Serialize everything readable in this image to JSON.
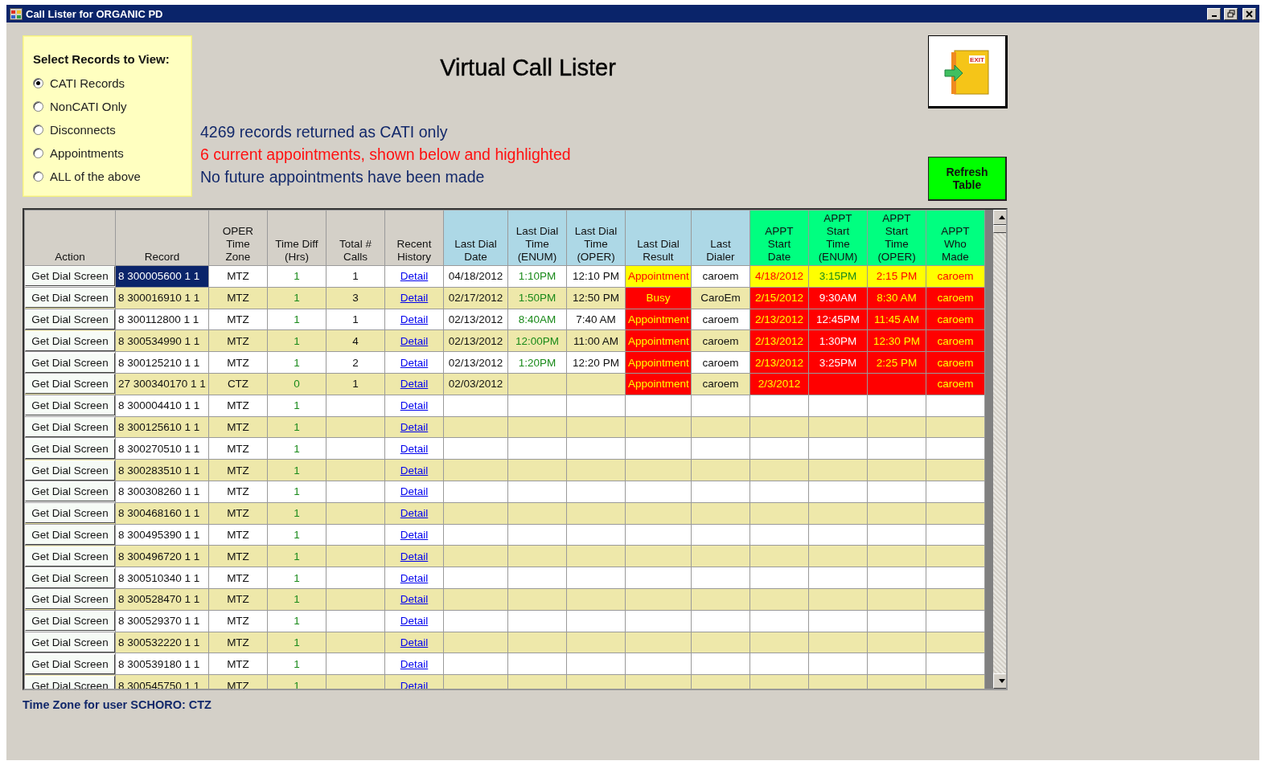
{
  "window": {
    "title": "Call Lister for ORGANIC PD"
  },
  "filter": {
    "heading": "Select Records to View:",
    "options": [
      {
        "label": "CATI Records",
        "selected": true
      },
      {
        "label": "NonCATI Only",
        "selected": false
      },
      {
        "label": "Disconnects",
        "selected": false
      },
      {
        "label": "Appointments",
        "selected": false
      },
      {
        "label": "ALL of the above",
        "selected": false
      }
    ]
  },
  "title": "Virtual Call Lister",
  "messages": [
    {
      "text": "4269 records returned as CATI only",
      "kind": "info"
    },
    {
      "text": "6 current appointments, shown below and highlighted",
      "kind": "alert"
    },
    {
      "text": "No future appointments have been made",
      "kind": "info"
    }
  ],
  "exit_button": {
    "label": "EXIT"
  },
  "refresh_button": {
    "label": "Refresh Table"
  },
  "table": {
    "columns": [
      {
        "lines": [
          "Action"
        ],
        "kind": "base"
      },
      {
        "lines": [
          "Record"
        ],
        "kind": "base"
      },
      {
        "lines": [
          "OPER",
          "Time",
          "Zone"
        ],
        "kind": "base"
      },
      {
        "lines": [
          "Time Diff",
          "(Hrs)"
        ],
        "kind": "base"
      },
      {
        "lines": [
          "Total #",
          "Calls"
        ],
        "kind": "base"
      },
      {
        "lines": [
          "Recent",
          "History"
        ],
        "kind": "base"
      },
      {
        "lines": [
          "Last Dial",
          "Date"
        ],
        "kind": "dial"
      },
      {
        "lines": [
          "Last Dial",
          "Time",
          "(ENUM)"
        ],
        "kind": "dial"
      },
      {
        "lines": [
          "Last Dial",
          "Time",
          "(OPER)"
        ],
        "kind": "dial"
      },
      {
        "lines": [
          "Last Dial",
          "Result"
        ],
        "kind": "dial"
      },
      {
        "lines": [
          "Last",
          "Dialer"
        ],
        "kind": "dial"
      },
      {
        "lines": [
          "APPT",
          "Start",
          "Date"
        ],
        "kind": "appt"
      },
      {
        "lines": [
          "APPT",
          "Start",
          "Time",
          "(ENUM)"
        ],
        "kind": "appt"
      },
      {
        "lines": [
          "APPT",
          "Start",
          "Time",
          "(OPER)"
        ],
        "kind": "appt"
      },
      {
        "lines": [
          "APPT",
          "Who",
          "Made"
        ],
        "kind": "appt"
      }
    ],
    "rows": [
      {
        "selected": true,
        "kind": "current",
        "cells": [
          "Get Dial Screen",
          "8 300005600 1 1",
          "MTZ",
          "1",
          "1",
          "Detail",
          "04/18/2012",
          "1:10PM",
          "12:10 PM",
          "Appointment",
          "caroem",
          "4/18/2012",
          "3:15PM",
          "2:15 PM",
          "caroem"
        ]
      },
      {
        "selected": false,
        "kind": "due",
        "cells": [
          "Get Dial Screen",
          "8 300016910 1 1",
          "MTZ",
          "1",
          "3",
          "Detail",
          "02/17/2012",
          "1:50PM",
          "12:50 PM",
          "Busy",
          "CaroEm",
          "2/15/2012",
          "9:30AM",
          "8:30 AM",
          "caroem"
        ]
      },
      {
        "selected": false,
        "kind": "due",
        "cells": [
          "Get Dial Screen",
          "8 300112800 1 1",
          "MTZ",
          "1",
          "1",
          "Detail",
          "02/13/2012",
          "8:40AM",
          "7:40 AM",
          "Appointment",
          "caroem",
          "2/13/2012",
          "12:45PM",
          "11:45 AM",
          "caroem"
        ]
      },
      {
        "selected": false,
        "kind": "due",
        "cells": [
          "Get Dial Screen",
          "8 300534990 1 1",
          "MTZ",
          "1",
          "4",
          "Detail",
          "02/13/2012",
          "12:00PM",
          "11:00 AM",
          "Appointment",
          "caroem",
          "2/13/2012",
          "1:30PM",
          "12:30 PM",
          "caroem"
        ]
      },
      {
        "selected": false,
        "kind": "due",
        "cells": [
          "Get Dial Screen",
          "8 300125210 1 1",
          "MTZ",
          "1",
          "2",
          "Detail",
          "02/13/2012",
          "1:20PM",
          "12:20 PM",
          "Appointment",
          "caroem",
          "2/13/2012",
          "3:25PM",
          "2:25 PM",
          "caroem"
        ]
      },
      {
        "selected": false,
        "kind": "due",
        "cells": [
          "Get Dial Screen",
          "27 300340170 1 1",
          "CTZ",
          "0",
          "1",
          "Detail",
          "02/03/2012",
          null,
          null,
          "Appointment",
          "caroem",
          "2/3/2012",
          null,
          null,
          "caroem"
        ]
      },
      {
        "selected": false,
        "kind": "plain",
        "cells": [
          "Get Dial Screen",
          "8 300004410 1 1",
          "MTZ",
          "1",
          null,
          "Detail"
        ]
      },
      {
        "selected": false,
        "kind": "plain",
        "cells": [
          "Get Dial Screen",
          "8 300125610 1 1",
          "MTZ",
          "1",
          null,
          "Detail"
        ]
      },
      {
        "selected": false,
        "kind": "plain",
        "cells": [
          "Get Dial Screen",
          "8 300270510 1 1",
          "MTZ",
          "1",
          null,
          "Detail"
        ]
      },
      {
        "selected": false,
        "kind": "plain",
        "cells": [
          "Get Dial Screen",
          "8 300283510 1 1",
          "MTZ",
          "1",
          null,
          "Detail"
        ]
      },
      {
        "selected": false,
        "kind": "plain",
        "cells": [
          "Get Dial Screen",
          "8 300308260 1 1",
          "MTZ",
          "1",
          null,
          "Detail"
        ]
      },
      {
        "selected": false,
        "kind": "plain",
        "cells": [
          "Get Dial Screen",
          "8 300468160 1 1",
          "MTZ",
          "1",
          null,
          "Detail"
        ]
      },
      {
        "selected": false,
        "kind": "plain",
        "cells": [
          "Get Dial Screen",
          "8 300495390 1 1",
          "MTZ",
          "1",
          null,
          "Detail"
        ]
      },
      {
        "selected": false,
        "kind": "plain",
        "cells": [
          "Get Dial Screen",
          "8 300496720 1 1",
          "MTZ",
          "1",
          null,
          "Detail"
        ]
      },
      {
        "selected": false,
        "kind": "plain",
        "cells": [
          "Get Dial Screen",
          "8 300510340 1 1",
          "MTZ",
          "1",
          null,
          "Detail"
        ]
      },
      {
        "selected": false,
        "kind": "plain",
        "cells": [
          "Get Dial Screen",
          "8 300528470 1 1",
          "MTZ",
          "1",
          null,
          "Detail"
        ]
      },
      {
        "selected": false,
        "kind": "plain",
        "cells": [
          "Get Dial Screen",
          "8 300529370 1 1",
          "MTZ",
          "1",
          null,
          "Detail"
        ]
      },
      {
        "selected": false,
        "kind": "plain",
        "cells": [
          "Get Dial Screen",
          "8 300532220 1 1",
          "MTZ",
          "1",
          null,
          "Detail"
        ]
      },
      {
        "selected": false,
        "kind": "plain",
        "cells": [
          "Get Dial Screen",
          "8 300539180 1 1",
          "MTZ",
          "1",
          null,
          "Detail"
        ]
      },
      {
        "selected": false,
        "kind": "plain",
        "cells": [
          "Get Dial Screen",
          "8 300545750 1 1",
          "MTZ",
          "1",
          null,
          "Detail"
        ]
      }
    ]
  },
  "status": "Time Zone for user SCHORO: CTZ"
}
